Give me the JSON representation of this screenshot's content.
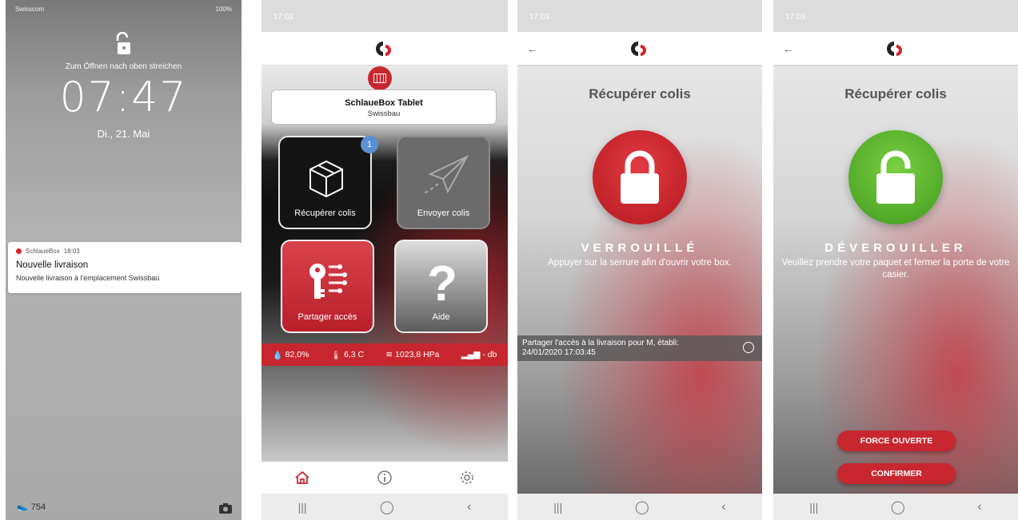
{
  "lock_screen": {
    "carrier": "Swisscom",
    "battery": "100%",
    "unlock_hint": "Zum Öffnen nach oben streichen",
    "time": "07:47",
    "date": "Di., 21. Mai",
    "notification": {
      "app": "SchlaueBox",
      "time": "18:03",
      "title": "Nouvelle livraison",
      "body": "Nouvelle livraison à l'emplacement Swissbau"
    },
    "steps": "754"
  },
  "home": {
    "status_time": "17:02",
    "device_name": "SchlaueBox Tablet",
    "device_location": "Swissbau",
    "tiles": {
      "receive": "Récupérer colis",
      "send": "Envoyer colis",
      "share": "Partager accès",
      "help": "Aide"
    },
    "pending_count": "1",
    "sensors": {
      "humidity": "82,0%",
      "temperature": "6,3 C",
      "pressure": "1023,8 HPa",
      "signal": "- db"
    }
  },
  "locked": {
    "status_time": "17:03",
    "title": "Récupérer colis",
    "state": "VERROUILLÉ",
    "description": "Appuyer sur la serrure afin d'ouvrir votre box.",
    "share_info_line1": "Partager l'accès à la livraison pour M, établi:",
    "share_info_line2": "24/01/2020 17:03:45"
  },
  "unlocked": {
    "status_time": "17:03",
    "title": "Récupérer colis",
    "state": "DÉVEROUILLER",
    "description": "Veuillez prendre votre paquet et fermer la porte de votre casier.",
    "force_label": "FORCE OUVERTE",
    "confirm_label": "CONFIRMER"
  },
  "colors": {
    "brand_red": "#c8272f",
    "unlock_green": "#5cb531",
    "badge_blue": "#5b8fd6"
  }
}
